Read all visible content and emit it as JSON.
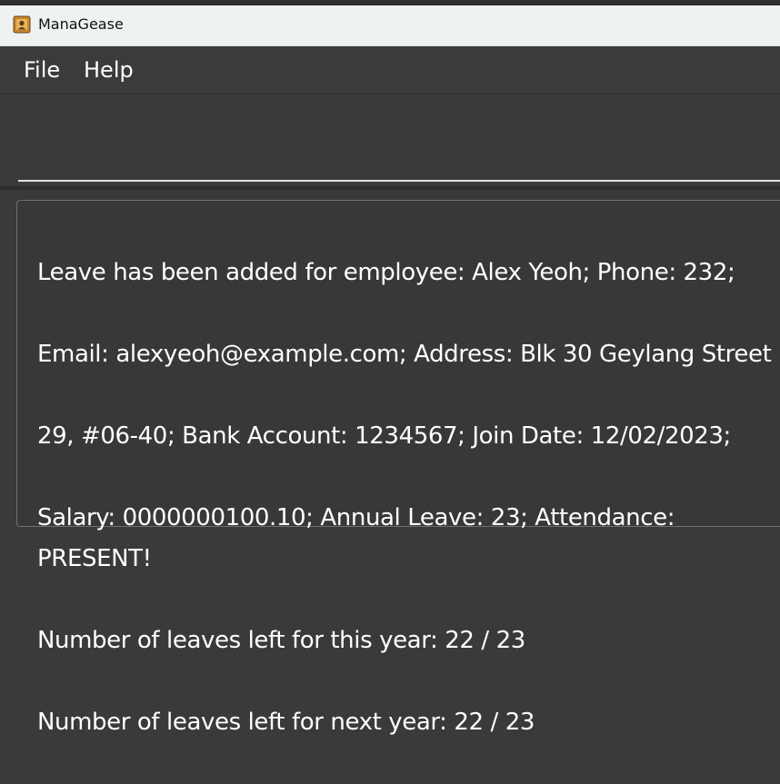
{
  "window": {
    "title": "ManaGease"
  },
  "menu": {
    "items": [
      "File",
      "Help"
    ]
  },
  "command_box": {
    "value": ""
  },
  "result": {
    "lines": [
      "Leave has been added for employee: Alex Yeoh; Phone: 232;",
      "Email: alexyeoh@example.com; Address: Blk 30 Geylang Street",
      "29, #06-40; Bank Account: 1234567; Join Date: 12/02/2023;",
      "Salary: 0000000100.10; Annual Leave: 23; Attendance: PRESENT!",
      "Number of leaves left for this year: 22 / 23",
      "Number of leaves left for next year: 22 / 23"
    ]
  },
  "colors": {
    "background": "#3a3a3a",
    "titlebar": "#eef3f2",
    "text": "#ffffff"
  }
}
